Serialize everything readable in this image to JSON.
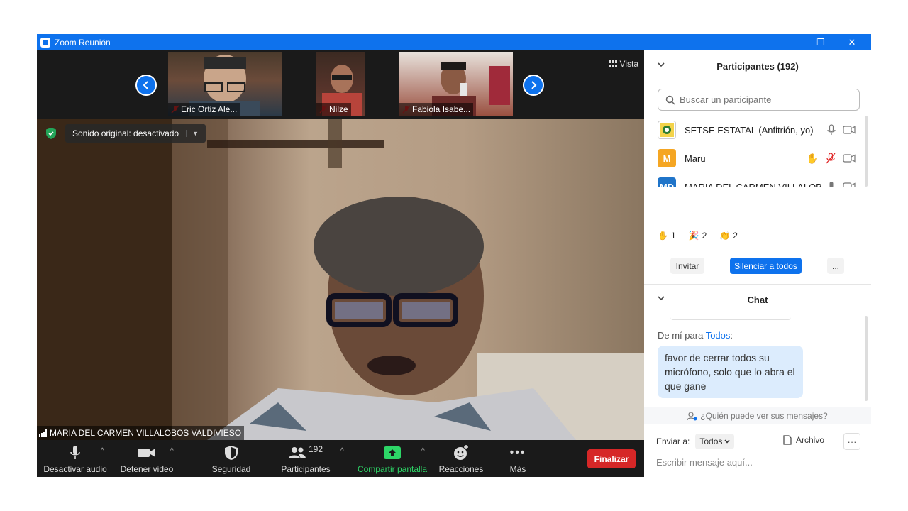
{
  "window": {
    "title": "Zoom Reunión",
    "controls": {
      "minimize": "—",
      "restore": "❐",
      "close": "✕"
    }
  },
  "gallery_strip": {
    "thumbnails": [
      {
        "name": "Eric Ortiz Ale..."
      },
      {
        "name": "Nilze"
      },
      {
        "name": "Fabiola Isabe..."
      }
    ],
    "view_label": "Vista"
  },
  "video": {
    "original_sound_label": "Sonido original: desactivado",
    "active_speaker": "MARIA DEL CARMEN VILLALOBOS VALDIVIESO"
  },
  "toolbar": {
    "mute_label": "Desactivar audio",
    "stop_video_label": "Detener video",
    "security_label": "Seguridad",
    "participants_label": "Participantes",
    "participants_count": "192",
    "share_label": "Compartir pantalla",
    "reactions_label": "Reacciones",
    "more_label": "Más",
    "end_label": "Finalizar"
  },
  "participants_panel": {
    "title": "Participantes (192)",
    "search_placeholder": "Buscar un participante",
    "participants": [
      {
        "name": "SETSE ESTATAL (Anfitrión, yo)",
        "avatar": "logo"
      },
      {
        "name": "Maru",
        "avatar": "M",
        "avatar_color": "#f5a623"
      },
      {
        "name": "MARIA DEL CARMEN VILLALOB...",
        "avatar": "MD",
        "avatar_color": "#1f74c9"
      }
    ],
    "reactions": [
      {
        "icon": "raised-hand",
        "emoji": "✋",
        "count": "1"
      },
      {
        "icon": "party-popper",
        "emoji": "🎉",
        "count": "2"
      },
      {
        "icon": "clapping-hands",
        "emoji": "👏",
        "count": "2"
      }
    ],
    "invite_label": "Invitar",
    "mute_all_label": "Silenciar a todos",
    "more_label": "..."
  },
  "chat_panel": {
    "title": "Chat",
    "message_meta_prefix": "De mí para ",
    "message_recipient": "Todos",
    "message_meta_suffix": ":",
    "message_text": "favor de cerrar todos su micrófono, solo que lo abra el que gane",
    "visibility_note": "¿Quién puede ver sus mensajes?",
    "send_to_label": "Enviar a:",
    "send_to_value": "Todos",
    "file_label": "Archivo",
    "more_label": "···",
    "input_placeholder": "Escribir mensaje aquí..."
  },
  "colors": {
    "zoom_blue": "#0e72ed",
    "end_red": "#d62727",
    "share_green": "#2dd667",
    "toolbar_bg": "#1a1a1a",
    "chat_bubble": "#dcecfd"
  }
}
